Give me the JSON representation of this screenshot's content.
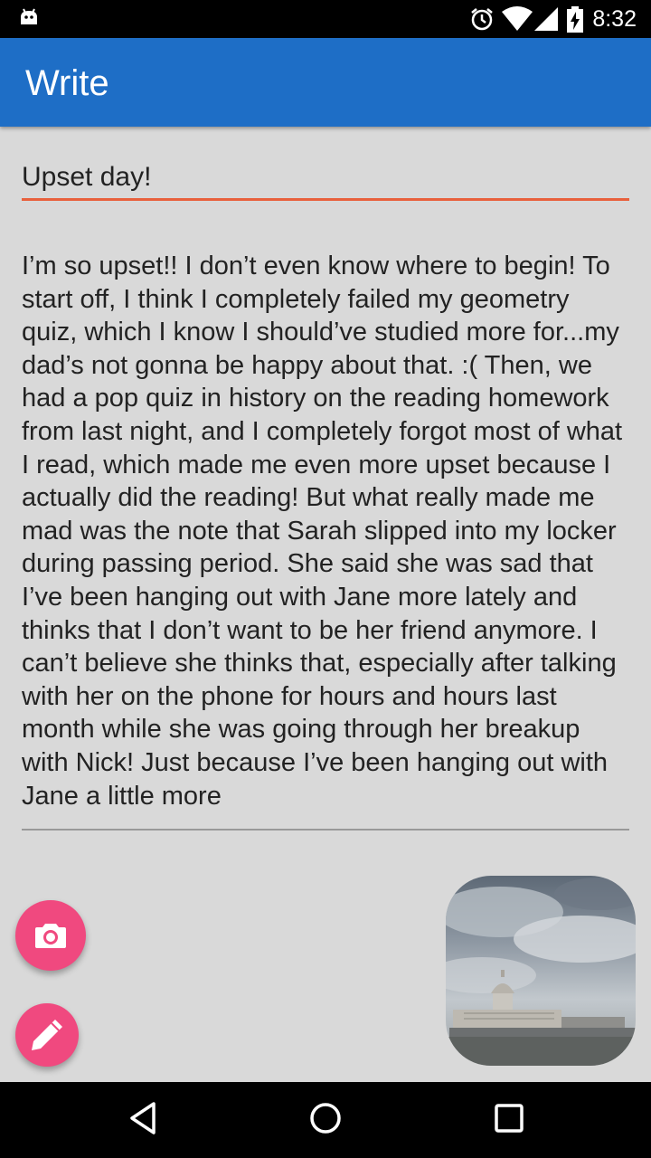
{
  "status_bar": {
    "time": "8:32",
    "icons": [
      "android-notification-icon",
      "alarm-icon",
      "wifi-icon",
      "cellular-signal-icon",
      "battery-charging-icon"
    ]
  },
  "app_bar": {
    "title": "Write",
    "color": "#1e6ec6"
  },
  "entry": {
    "title": "Upset day!",
    "body": "I’m so upset!! I don’t even know where to begin! To start off, I think I completely failed my geometry quiz, which I know I should’ve studied more for...my dad’s not gonna be happy about that. :( Then, we had a pop quiz in history on the reading homework from last night, and I completely forgot most of what I read, which made me even more upset because I actually did the reading! But what really made me mad was the note that Sarah slipped into my locker during passing period. She said she was sad that I’ve been hanging out with Jane more lately and thinks that I don’t want to be her friend anymore. I can’t believe she thinks that, especially after talking with her on the phone for hours and hours last month while she was going through her breakup with Nick! Just because I’ve been hanging out with Jane a little more"
  },
  "actions": {
    "camera_icon": "camera-icon",
    "draw_icon": "pencil-icon",
    "accent_color": "#f0497f",
    "underline_color": "#e8603c"
  },
  "attachment": {
    "subject": "capitol-building-photo"
  },
  "nav_bar": {
    "buttons": [
      "back-icon",
      "home-icon",
      "recents-icon"
    ]
  }
}
